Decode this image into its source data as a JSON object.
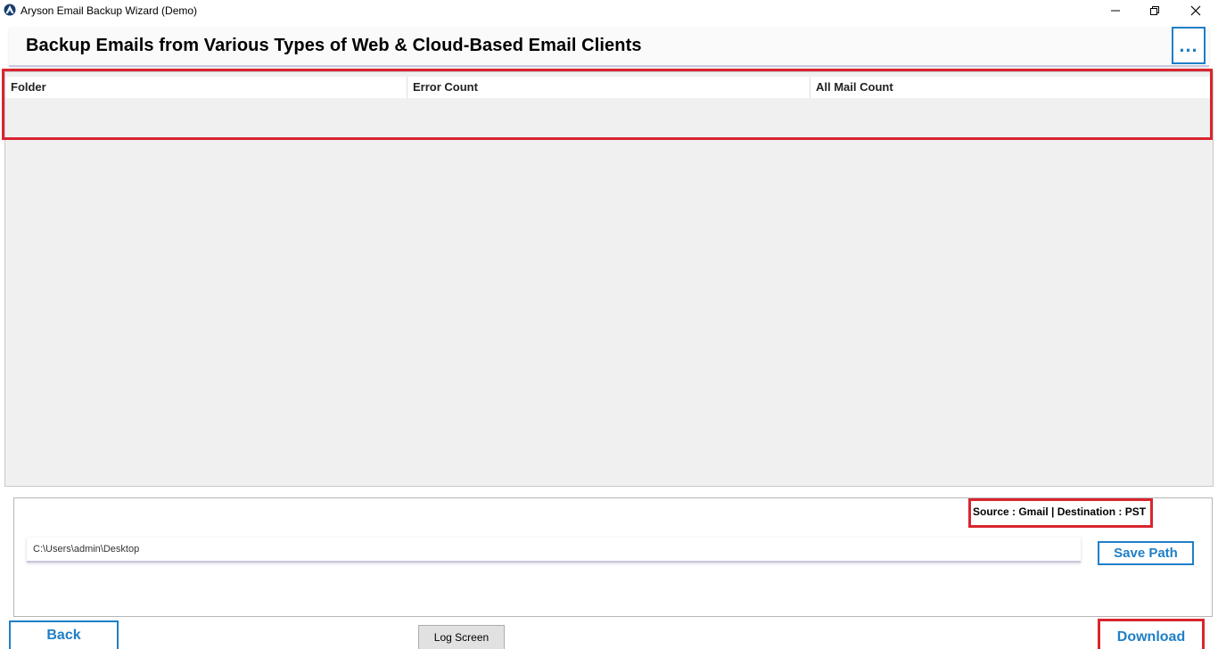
{
  "window": {
    "title": "Aryson Email Backup Wizard (Demo)",
    "app_icon": "aryson-logo-icon",
    "controls": [
      "minimize-icon",
      "restore-icon",
      "close-icon"
    ]
  },
  "header": {
    "title": "Backup Emails from Various Types of Web & Cloud-Based Email Clients",
    "more_label": "..."
  },
  "grid": {
    "columns": [
      "Folder",
      "Error Count",
      "All Mail Count"
    ],
    "rows": []
  },
  "bottom": {
    "source_destination": "Source : Gmail | Destination : PST",
    "path_value": "C:\\Users\\admin\\Desktop",
    "save_path_label": "Save Path"
  },
  "footer": {
    "back_label": "Back",
    "log_label": "Log Screen",
    "download_label": "Download"
  },
  "colors": {
    "accent_blue": "#1f7fc7",
    "highlight_red": "#d9252f",
    "grid_bg": "#f0f0f0"
  }
}
